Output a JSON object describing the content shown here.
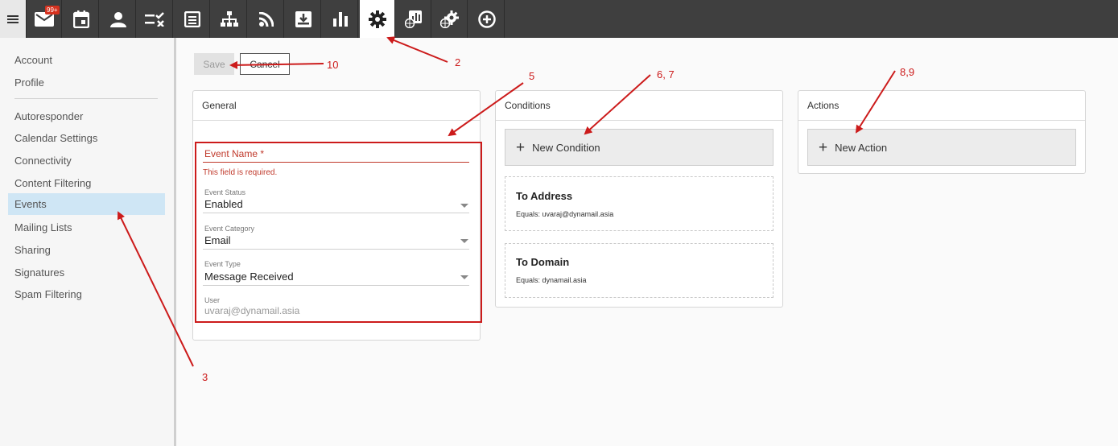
{
  "toolbar": {
    "mail_badge": "99+",
    "icons": [
      "menu-icon",
      "mail-icon",
      "calendar-icon",
      "contact-icon",
      "tasks-icon",
      "notes-icon",
      "hierarchy-icon",
      "rss-icon",
      "archive-icon",
      "reports-icon",
      "settings-icon",
      "domain-reports-icon",
      "domain-settings-icon",
      "add-icon"
    ]
  },
  "sidebar": {
    "top_items": [
      "Account",
      "Profile"
    ],
    "items": [
      "Autoresponder",
      "Calendar Settings",
      "Connectivity",
      "Content Filtering",
      "Events",
      "Mailing Lists",
      "Sharing",
      "Signatures",
      "Spam Filtering"
    ],
    "active": "Events"
  },
  "actions": {
    "save": "Save",
    "cancel": "Cancel"
  },
  "general": {
    "title": "General",
    "event_name_label": "Event Name *",
    "event_name_error": "This field is required.",
    "status_label": "Event Status",
    "status_value": "Enabled",
    "category_label": "Event Category",
    "category_value": "Email",
    "type_label": "Event Type",
    "type_value": "Message Received",
    "user_label": "User",
    "user_value": "uvaraj@dynamail.asia"
  },
  "conditions": {
    "title": "Conditions",
    "new_label": "New Condition",
    "cards": [
      {
        "title": "To Address",
        "sub": "Equals: uvaraj@dynamail.asia"
      },
      {
        "title": "To Domain",
        "sub": "Equals: dynamail.asia"
      }
    ]
  },
  "actions_panel": {
    "title": "Actions",
    "new_label": "New Action"
  },
  "annotations": [
    "2",
    "3",
    "5",
    "6, 7",
    "8,9",
    "10"
  ],
  "colors": {
    "annotation": "#cc1b1b",
    "topbar": "#3f3f3f",
    "active_item": "#cfe6f5"
  }
}
